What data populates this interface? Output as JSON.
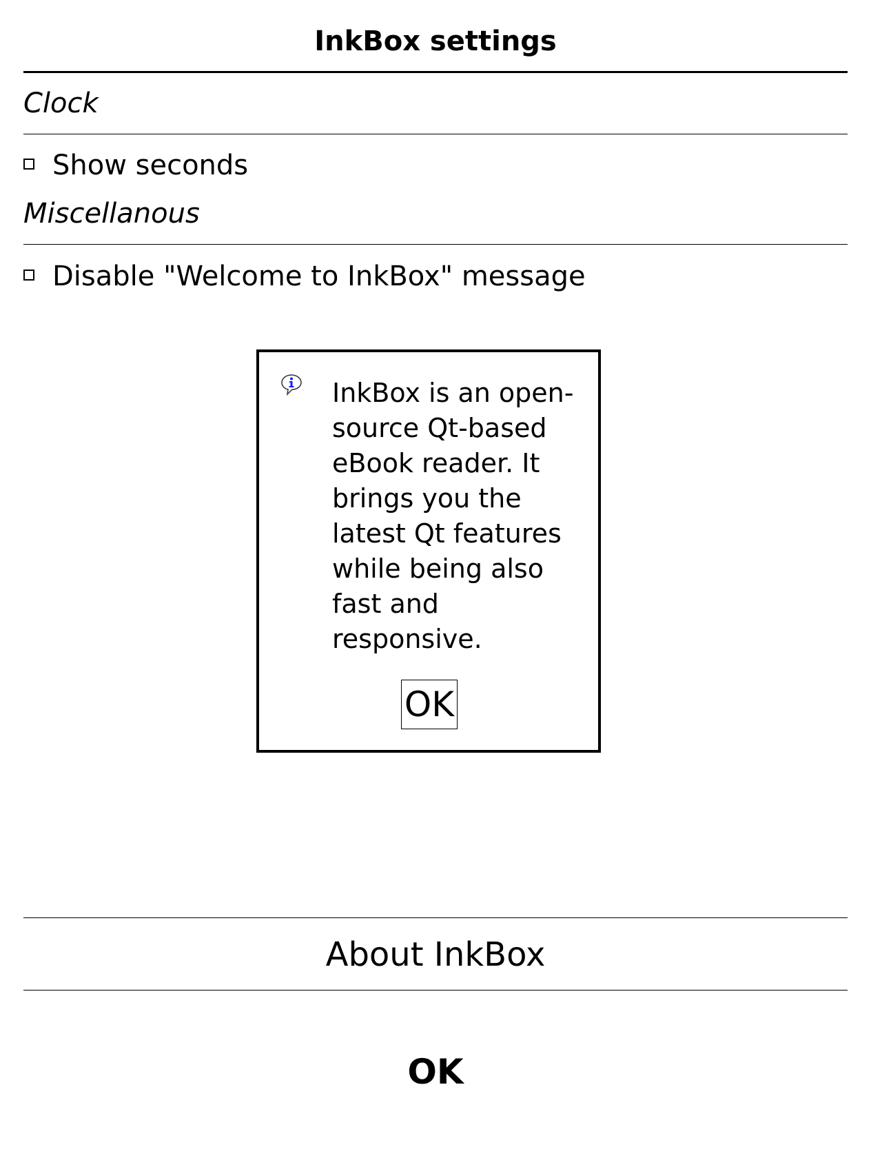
{
  "header": {
    "title": "InkBox settings"
  },
  "sections": {
    "clock": {
      "label": "Clock",
      "show_seconds": {
        "label": "Show seconds",
        "checked": false
      }
    },
    "misc": {
      "label": "Miscellanous",
      "disable_welcome": {
        "label": "Disable \"Welcome to InkBox\" message",
        "checked": false
      }
    }
  },
  "dialog": {
    "icon": "info-icon",
    "message": "InkBox is an open-source Qt-based eBook reader. It brings you the latest Qt features while being also fast and responsive.",
    "ok_label": "OK"
  },
  "footer": {
    "about_label": "About InkBox",
    "ok_label": "OK"
  },
  "colors": {
    "foreground": "#000000",
    "background": "#ffffff",
    "icon_accent": "#1a1aff"
  }
}
